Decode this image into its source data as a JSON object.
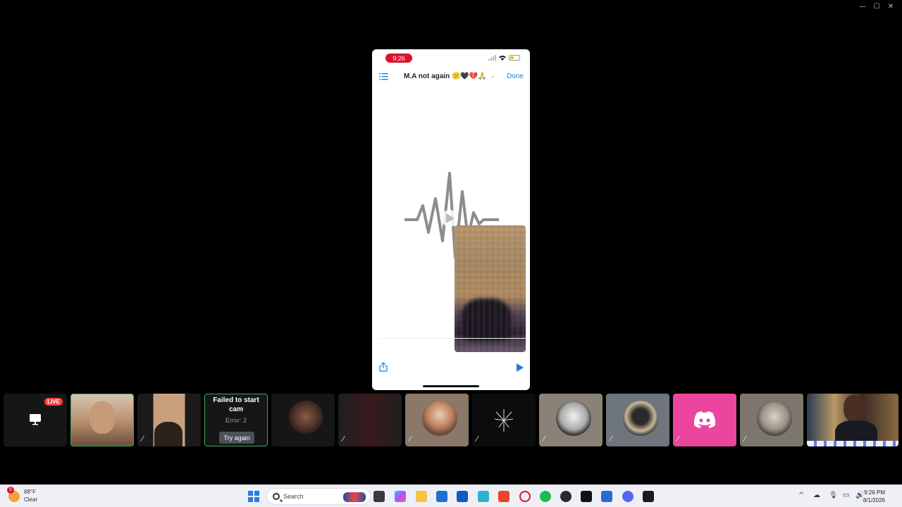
{
  "window": {
    "minimize_glyph": "—",
    "maximize_glyph": "☐",
    "close_glyph": "✕"
  },
  "phone": {
    "status_time": "9:26",
    "title": "M.A not again 😕🖤💔🙏",
    "done_label": "Done"
  },
  "strip": {
    "live_label": "LIVE",
    "failed_title": "Failed to start cam",
    "failed_error": "Error: 2",
    "try_again_label": "Try again"
  },
  "taskbar": {
    "weather_temp": "88°F",
    "weather_cond": "Clear",
    "weather_badge": "5",
    "search_placeholder": "Search",
    "time": "9:26 PM",
    "date": "8/1/2026",
    "tray_chevron": "^"
  },
  "colors": {
    "accent_blue": "#1a7fdc",
    "live_red": "#ed4245",
    "discord_pink": "#eb459e",
    "selected_green": "#3ba55d"
  }
}
